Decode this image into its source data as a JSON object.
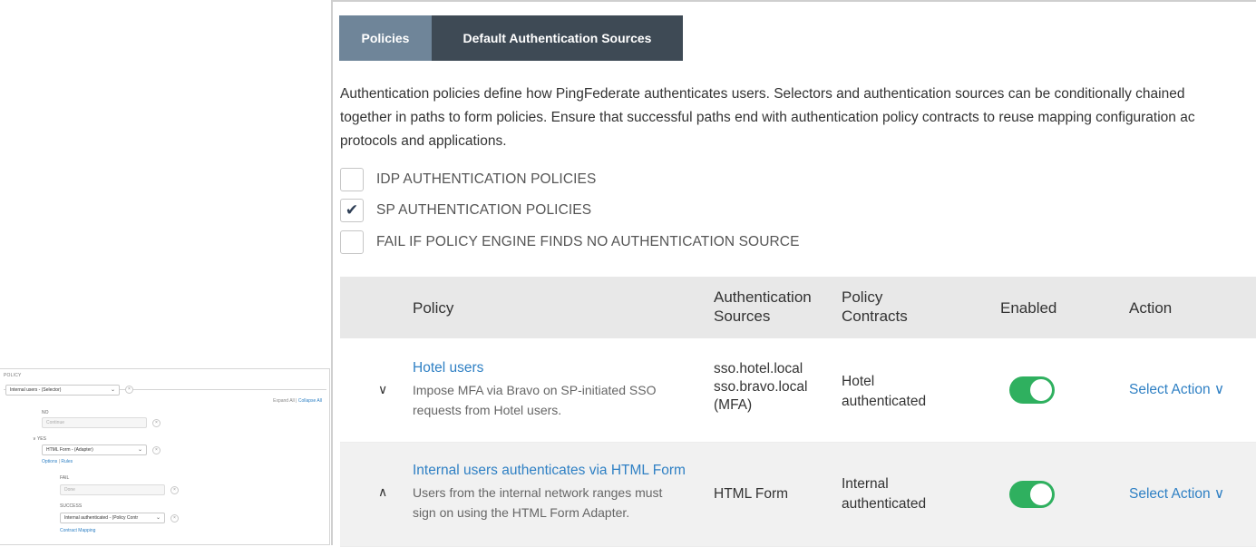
{
  "tabs": {
    "policies": "Policies",
    "default_sources": "Default Authentication Sources"
  },
  "description": {
    "line1": "Authentication policies define how PingFederate authenticates users. Selectors and authentication sources can be conditionally chained",
    "line2": "together in paths to form policies. Ensure that successful paths end with authentication policy contracts to reuse mapping configuration ac",
    "line3": "protocols and applications."
  },
  "options": [
    {
      "label": "IDP AUTHENTICATION POLICIES",
      "checked": false
    },
    {
      "label": "SP AUTHENTICATION POLICIES",
      "checked": true
    },
    {
      "label": "FAIL IF POLICY ENGINE FINDS NO AUTHENTICATION SOURCE",
      "checked": false
    }
  ],
  "table": {
    "headers": {
      "policy": "Policy",
      "sources_1": "Authentication",
      "sources_2": "Sources",
      "contracts_1": "Policy",
      "contracts_2": "Contracts",
      "enabled": "Enabled",
      "action": "Action"
    },
    "rows": [
      {
        "caret": "∨",
        "name": "Hotel users",
        "desc1": "Impose MFA via Bravo on SP-initiated SSO",
        "desc2": "requests from Hotel users.",
        "src1": "sso.hotel.local",
        "src2": "sso.bravo.local",
        "src3": "(MFA)",
        "contract1": "Hotel",
        "contract2": "authenticated",
        "enabled": true,
        "action": "Select Action ∨"
      },
      {
        "caret": "∧",
        "name": "Internal users authenticates via HTML Form",
        "desc1": "Users from the internal network ranges must",
        "desc2": "sign on using the HTML Form Adapter.",
        "src1": "HTML Form",
        "contract1": "Internal",
        "contract2": "authenticated",
        "enabled": true,
        "action": "Select Action ∨"
      }
    ]
  },
  "inset": {
    "policy_label": "POLICY",
    "selector": "Internal users - (Selector)",
    "expand_all": "Expand All",
    "separator": "|",
    "collapse_all": "Collapse All",
    "no_label": "NO",
    "no_value": "Continue",
    "yes_label": "YES",
    "adapter": "HTML Form - (Adapter)",
    "options_link": "Options",
    "rules_link": "Rules",
    "fail_label": "FAIL",
    "fail_value": "Done",
    "success_label": "SUCCESS",
    "success_value": "Internal authenticated - (Policy Contr",
    "contract_mapping": "Contract Mapping"
  },
  "colors": {
    "tab_active": "#6f8599",
    "tab_inactive": "#3e4a55",
    "link": "#2f80c4",
    "toggle_on": "#2fb05f"
  }
}
